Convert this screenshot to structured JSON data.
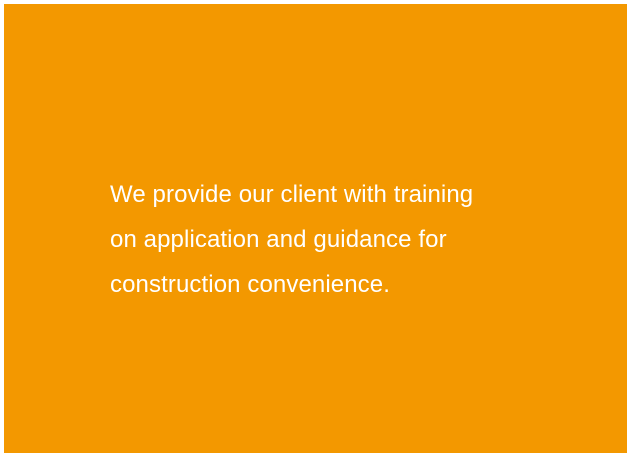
{
  "panel": {
    "background_color": "#f39800",
    "text_color": "#ffffff",
    "lines": [
      "We provide our client with training",
      "on application and guidance for",
      "construction convenience."
    ]
  }
}
